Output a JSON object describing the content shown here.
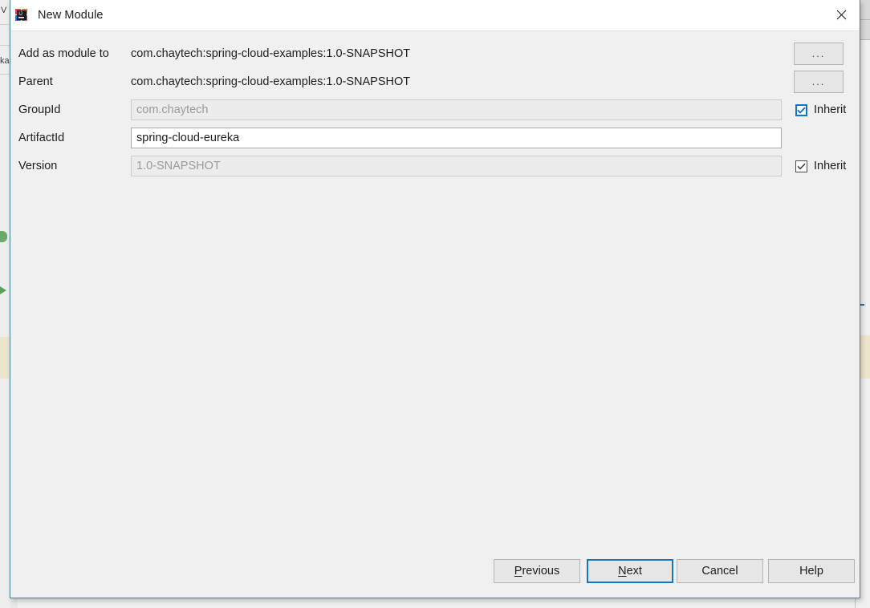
{
  "background": {
    "left_fragment_top": "V",
    "left_fragment_mid": "ka"
  },
  "dialog": {
    "title": "New Module",
    "app_icon": "intellij-idea-icon",
    "close_icon": "close-icon",
    "form": {
      "rows": [
        {
          "label": "Add as module to",
          "kind": "static",
          "value": "com.chaytech:spring-cloud-examples:1.0-SNAPSHOT",
          "button": "...",
          "button_icon": "ellipsis-icon"
        },
        {
          "label": "Parent",
          "kind": "static",
          "value": "com.chaytech:spring-cloud-examples:1.0-SNAPSHOT",
          "button": "...",
          "button_icon": "ellipsis-icon"
        },
        {
          "label": "GroupId",
          "kind": "input",
          "value": "com.chaytech",
          "enabled": false,
          "checkbox_label": "Inherit",
          "checkbox_checked": true,
          "checkbox_focused": true
        },
        {
          "label": "ArtifactId",
          "kind": "input",
          "value": "spring-cloud-eureka",
          "enabled": true,
          "checkbox_label": null
        },
        {
          "label": "Version",
          "kind": "input",
          "value": "1.0-SNAPSHOT",
          "enabled": false,
          "checkbox_label": "Inherit",
          "checkbox_checked": true,
          "checkbox_focused": false
        }
      ]
    },
    "footer": {
      "buttons": [
        {
          "label": "Previous",
          "mnemonic": "P",
          "default": false
        },
        {
          "label": "Next",
          "mnemonic": "N",
          "default": true
        },
        {
          "label": "Cancel",
          "mnemonic": null,
          "default": false
        },
        {
          "label": "Help",
          "mnemonic": null,
          "default": false
        }
      ]
    }
  },
  "colors": {
    "dialog_border": "#4c7f99",
    "accent_focus": "#1675c0",
    "dialog_bg": "#f0f0f0",
    "titlebar_bg": "#ffffff",
    "disabled_field_bg": "#ececec",
    "disabled_text": "#9a9a9a"
  }
}
